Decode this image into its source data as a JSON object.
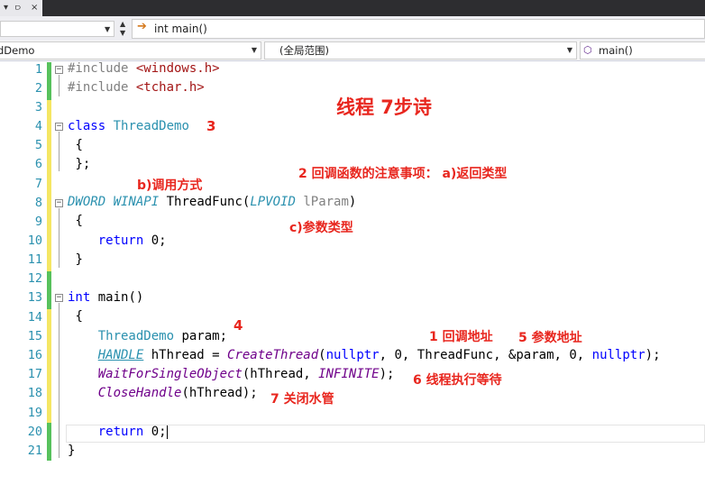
{
  "title_bar": {
    "tab_label": "▾",
    "pin": "⫐",
    "close": "×"
  },
  "toolbar": {
    "nav_arrow": "➔",
    "nav_text": "int main()"
  },
  "nav_bar": {
    "project": "dDemo",
    "scope": "(全局范围)",
    "member": "main()"
  },
  "line_numbers": [
    "1",
    "2",
    "3",
    "4",
    "5",
    "6",
    "7",
    "8",
    "9",
    "10",
    "11",
    "12",
    "13",
    "14",
    "15",
    "16",
    "17",
    "18",
    "19",
    "20",
    "21"
  ],
  "code": {
    "l1_pp": "#include ",
    "l1_inc": "<windows.h>",
    "l2_pp": "#include ",
    "l2_inc": "<tchar.h>",
    "l4_kw": "class",
    "l4_name": "ThreadDemo",
    "l5": "{",
    "l6": "};",
    "l8_t1": "DWORD",
    "l8_t2": "WINAPI",
    "l8_fn": "ThreadFunc(",
    "l8_ty": "LPVOID",
    "l8_par": "lParam",
    "l8_close": ")",
    "l9": "{",
    "l10_kw": "return",
    "l10_rest": " 0;",
    "l11": "}",
    "l13_kw": "int",
    "l13_rest": " main()",
    "l14": "{",
    "l15_ty": "ThreadDemo",
    "l15_rest": " param;",
    "l16_ty": "HANDLE",
    "l16_a": " hThread = ",
    "l16_fn": "CreateThread",
    "l16_b": "(",
    "l16_kw1": "nullptr",
    "l16_c": ", 0, ",
    "l16_ty2": "ThreadFunc",
    "l16_d": ", &param, 0, ",
    "l16_kw2": "nullptr",
    "l16_e": ");",
    "l17_fn": "WaitForSingleObject",
    "l17_a": "(hThread, ",
    "l17_mac": "INFINITE",
    "l17_b": ");",
    "l18_fn": "CloseHandle",
    "l18_a": "(hThread);",
    "l20_kw": "return",
    "l20_rest": " 0;",
    "l21": "}"
  },
  "annotations": {
    "title": "线程  7步诗",
    "a3": "3",
    "b": "b)调用方式",
    "a2": "2  回调函数的注意事项：  a)返回类型",
    "c": "c)参数类型",
    "a4": "4",
    "a1": "1 回调地址",
    "a5": "5  参数地址",
    "a6": "6  线程执行等待",
    "a7": "7  关闭水管"
  },
  "colors": {
    "keyword": "#0000ff",
    "type": "#2b91af",
    "string": "#a31515",
    "annotation": "#e8261e",
    "changed_saved": "#57c15c",
    "changed_unsaved": "#f5e663"
  }
}
